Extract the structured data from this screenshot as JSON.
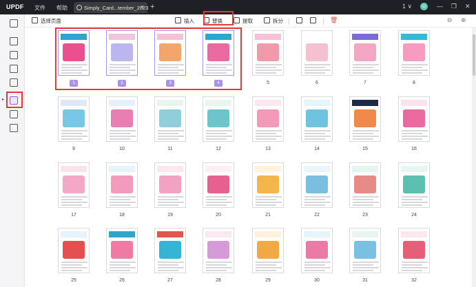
{
  "app": {
    "logo_text": "UPDF",
    "menu": [
      "文件",
      "帮助"
    ],
    "tab_title": "Simply_Card...tember_2023",
    "tab_close": "×",
    "new_tab": "+",
    "avatar_letter": "U",
    "window_controls": [
      "1 ∨",
      "—",
      "❐",
      "✕"
    ]
  },
  "toolbar": {
    "select_pages": "选择页面",
    "insert": "插入",
    "replace": "替换",
    "extract": "提取",
    "split": "拆分"
  },
  "colors": {
    "accent": "#8b57e0",
    "highlight": "#e53935",
    "badge": "#a892ee"
  },
  "pages": [
    {
      "num": "1",
      "selected": true,
      "band": "#2aa7c9",
      "img": "#e8508e"
    },
    {
      "num": "2",
      "selected": true,
      "band": "#f1c6dd",
      "img": "#b9b6f0"
    },
    {
      "num": "3",
      "selected": true,
      "band": "#f6c0d6",
      "img": "#f3a56b"
    },
    {
      "num": "4",
      "selected": true,
      "band": "#2aa7c9",
      "img": "#e96aa1"
    },
    {
      "num": "5",
      "selected": false,
      "band": "#f6c0d6",
      "img": "#f19aaa"
    },
    {
      "num": "6",
      "selected": false,
      "band": "#ffffff",
      "img": "#f5c0cf"
    },
    {
      "num": "7",
      "selected": false,
      "band": "#7b6bd6",
      "img": "#f4a7c5"
    },
    {
      "num": "8",
      "selected": false,
      "band": "#3ab5d8",
      "img": "#f59ac0"
    },
    {
      "num": "9",
      "selected": false,
      "band": "#dfe9f5",
      "img": "#79c7e6"
    },
    {
      "num": "10",
      "selected": false,
      "band": "#e8f0fb",
      "img": "#e67fb2"
    },
    {
      "num": "11",
      "selected": false,
      "band": "#e9f6ef",
      "img": "#8ecfd9"
    },
    {
      "num": "12",
      "selected": false,
      "band": "#e9f6ef",
      "img": "#6cc6c9"
    },
    {
      "num": "13",
      "selected": false,
      "band": "#fde7ee",
      "img": "#f29ab8"
    },
    {
      "num": "14",
      "selected": false,
      "band": "#e5f6fb",
      "img": "#6ec3de"
    },
    {
      "num": "15",
      "selected": false,
      "band": "#1f2b44",
      "img": "#f08a4b"
    },
    {
      "num": "16",
      "selected": false,
      "band": "#fce4ef",
      "img": "#ea6a9f"
    },
    {
      "num": "17",
      "selected": false,
      "band": "#fde2ec",
      "img": "#f3a9c6"
    },
    {
      "num": "18",
      "selected": false,
      "band": "#e7f3fb",
      "img": "#f29bbd"
    },
    {
      "num": "19",
      "selected": false,
      "band": "#fbe7f0",
      "img": "#f2a3c4"
    },
    {
      "num": "20",
      "selected": false,
      "band": "#fdf0f5",
      "img": "#e86090"
    },
    {
      "num": "21",
      "selected": false,
      "band": "#fff3dc",
      "img": "#f4b54a"
    },
    {
      "num": "22",
      "selected": false,
      "band": "#eaf4fb",
      "img": "#78bfe0"
    },
    {
      "num": "23",
      "selected": false,
      "band": "#e6f6ef",
      "img": "#e78b86"
    },
    {
      "num": "24",
      "selected": false,
      "band": "#e6f6f0",
      "img": "#5cc0b0"
    },
    {
      "num": "25",
      "selected": false,
      "band": "#e8f2fb",
      "img": "#e45050"
    },
    {
      "num": "26",
      "selected": false,
      "band": "#2aa7c9",
      "img": "#ef7aa3"
    },
    {
      "num": "27",
      "selected": false,
      "band": "#e2564e",
      "img": "#35b5d6"
    },
    {
      "num": "28",
      "selected": false,
      "band": "#fbe9f1",
      "img": "#d79ad8"
    },
    {
      "num": "29",
      "selected": false,
      "band": "#fff2dc",
      "img": "#f1a945"
    },
    {
      "num": "30",
      "selected": false,
      "band": "#e6f4fb",
      "img": "#ea7aa6"
    },
    {
      "num": "31",
      "selected": false,
      "band": "#e9f5f0",
      "img": "#7bbfe3"
    },
    {
      "num": "32",
      "selected": false,
      "band": "#fbe8ee",
      "img": "#e45f77"
    }
  ]
}
